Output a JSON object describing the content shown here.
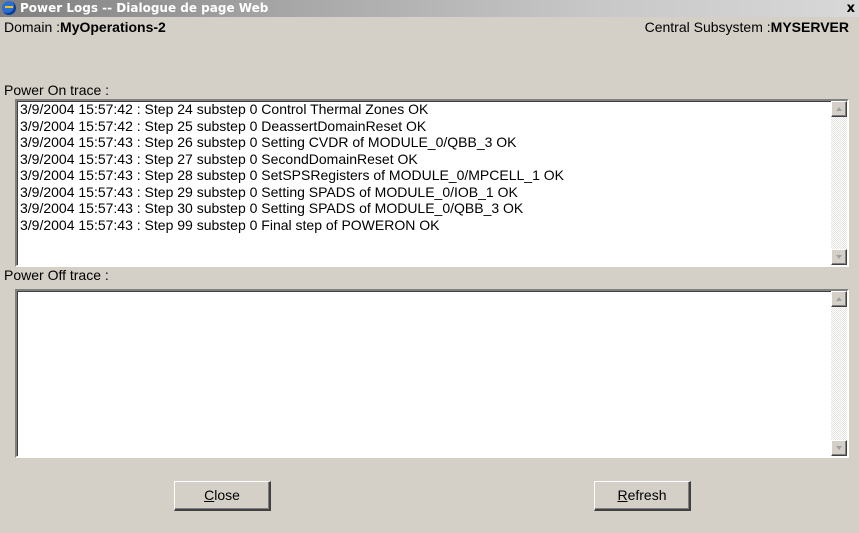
{
  "window": {
    "title": "Power Logs -- Dialogue de page Web",
    "close_glyph": "x",
    "icon": "ie-page-icon"
  },
  "header": {
    "domain_label": "Domain :",
    "domain_value": "MyOperations-2",
    "server_label": "Central Subsystem :",
    "server_value": "MYSERVER"
  },
  "power_on": {
    "label": "Power On trace :",
    "lines": [
      "3/9/2004 15:57:42 : Step 24 substep 0 Control Thermal Zones OK",
      "3/9/2004 15:57:42 : Step 25 substep 0 DeassertDomainReset OK",
      "3/9/2004 15:57:43 : Step 26 substep 0 Setting CVDR of MODULE_0/QBB_3 OK",
      "3/9/2004 15:57:43 : Step 27 substep 0 SecondDomainReset OK",
      "3/9/2004 15:57:43 : Step 28 substep 0 SetSPSRegisters of MODULE_0/MPCELL_1 OK",
      "3/9/2004 15:57:43 : Step 29 substep 0 Setting SPADS of MODULE_0/IOB_1 OK",
      "3/9/2004 15:57:43 : Step 30 substep 0 Setting SPADS of MODULE_0/QBB_3 OK",
      "3/9/2004 15:57:43 : Step 99 substep 0 Final step of POWERON OK"
    ]
  },
  "power_off": {
    "label": "Power Off trace :",
    "lines": []
  },
  "buttons": {
    "close_mnemonic": "C",
    "close_rest": "lose",
    "refresh_mnemonic": "R",
    "refresh_rest": "efresh"
  }
}
